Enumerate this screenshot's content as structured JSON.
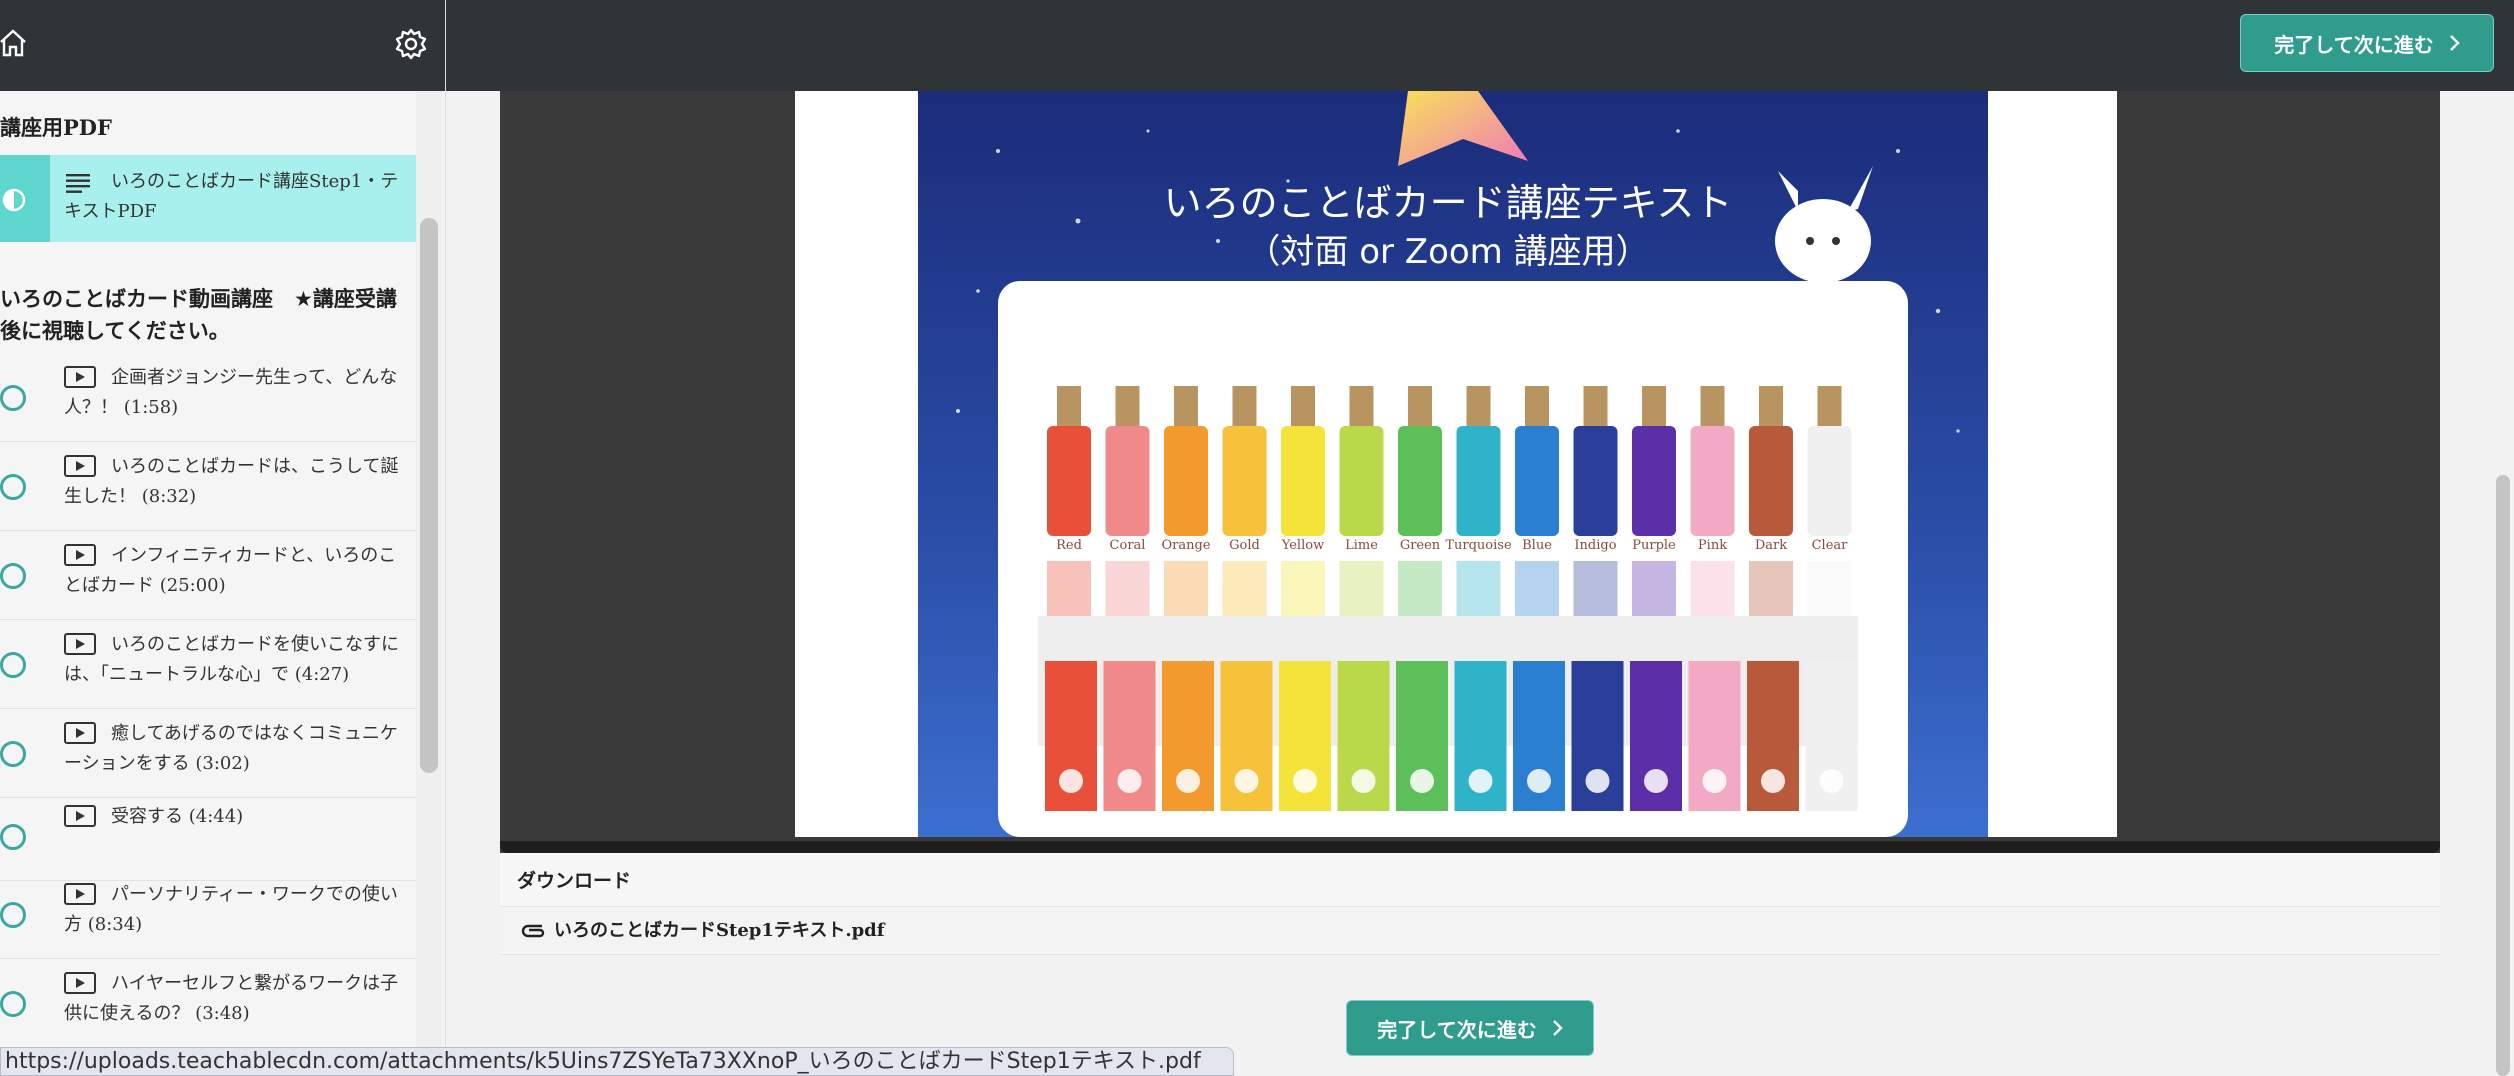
{
  "sidebar": {
    "section1_title": "講座用PDF",
    "active_item": {
      "label": "いろのことばカード講座Step1・テキストPDF"
    },
    "section2_title": "いろのことばカード動画講座　★講座受講後に視聴してください。",
    "lessons": [
      {
        "label": "企画者ジョンジー先生って、どんな人？！ (1:58)"
      },
      {
        "label": "いろのことばカードは、こうして誕生した！ (8:32)"
      },
      {
        "label": "インフィニティカードと、いろのことばカード (25:00)"
      },
      {
        "label": "いろのことばカードを使いこなすには、「ニュートラルな心」で (4:27)"
      },
      {
        "label": "癒してあげるのではなくコミュニケーションをする (3:02)"
      },
      {
        "label": "受容する (4:44)"
      },
      {
        "label": "パーソナリティー・ワークでの使い方 (8:34)"
      },
      {
        "label": "ハイヤーセルフと繋がるワークは子供に使えるの？ (3:48)"
      }
    ]
  },
  "topbar": {
    "complete_button": "完了して次に進む"
  },
  "pdf": {
    "title_line1": "いろのことばカード講座テキスト",
    "title_line2": "（対面 or Zoom 講座用）",
    "bottles": [
      {
        "name": "Red",
        "color": "#e8503a"
      },
      {
        "name": "Coral",
        "color": "#f08a8a"
      },
      {
        "name": "Orange",
        "color": "#f39a2e"
      },
      {
        "name": "Gold",
        "color": "#f6c23a"
      },
      {
        "name": "Yellow",
        "color": "#f4e43a"
      },
      {
        "name": "Lime",
        "color": "#b9d84a"
      },
      {
        "name": "Green",
        "color": "#5cbf5a"
      },
      {
        "name": "Turquoise",
        "color": "#2fb3c8"
      },
      {
        "name": "Blue",
        "color": "#2a7fd0"
      },
      {
        "name": "Indigo",
        "color": "#2a3f9a"
      },
      {
        "name": "Purple",
        "color": "#5a2fa8"
      },
      {
        "name": "Pink",
        "color": "#f2a9c4"
      },
      {
        "name": "Dark",
        "color": "#b85a3a"
      },
      {
        "name": "Clear",
        "color": "#f0f0f0"
      }
    ]
  },
  "download": {
    "title": "ダウンロード",
    "file_name": "いろのことばカードStep1テキスト.pdf"
  },
  "bottom": {
    "complete_button": "完了して次に進む"
  },
  "statusbar": {
    "url": "https://uploads.teachablecdn.com/attachments/k5Uins7ZSYeTa73XXnoP_いろのことばカードStep1テキスト.pdf"
  }
}
